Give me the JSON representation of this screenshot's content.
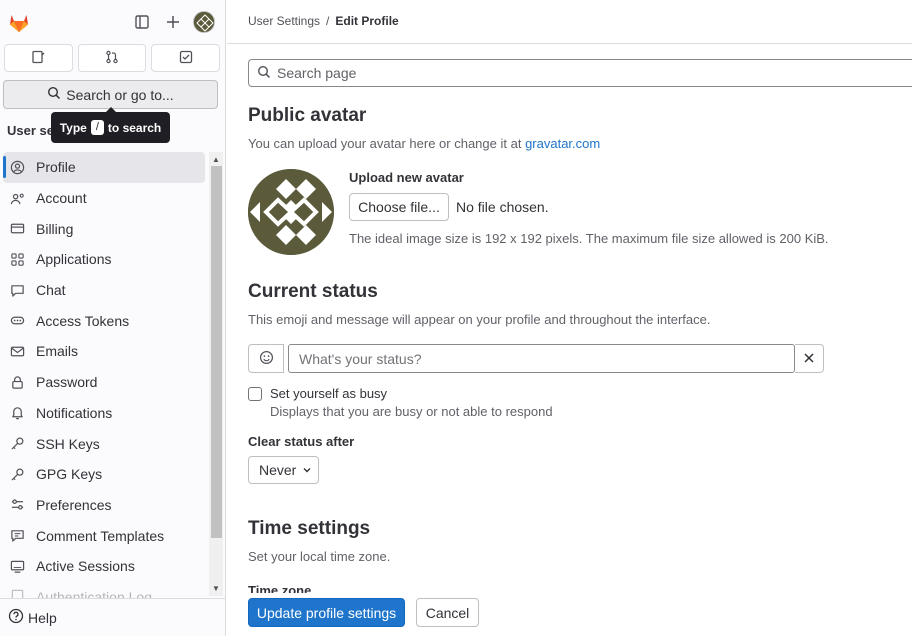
{
  "sidebar": {
    "search_label": "Search or go to...",
    "tooltip": {
      "prefix": "Type",
      "key": "/",
      "suffix": "to search"
    },
    "section_title": "User settings",
    "items": [
      {
        "label": "Profile",
        "icon": "profile-icon",
        "active": true
      },
      {
        "label": "Account",
        "icon": "account-icon"
      },
      {
        "label": "Billing",
        "icon": "billing-icon"
      },
      {
        "label": "Applications",
        "icon": "applications-icon"
      },
      {
        "label": "Chat",
        "icon": "chat-icon"
      },
      {
        "label": "Access Tokens",
        "icon": "access-tokens-icon"
      },
      {
        "label": "Emails",
        "icon": "email-icon"
      },
      {
        "label": "Password",
        "icon": "lock-icon"
      },
      {
        "label": "Notifications",
        "icon": "bell-icon"
      },
      {
        "label": "SSH Keys",
        "icon": "key-icon"
      },
      {
        "label": "GPG Keys",
        "icon": "key-icon"
      },
      {
        "label": "Preferences",
        "icon": "preferences-icon"
      },
      {
        "label": "Comment Templates",
        "icon": "comment-icon"
      },
      {
        "label": "Active Sessions",
        "icon": "monitor-icon"
      },
      {
        "label": "Authentication Log",
        "icon": "log-icon"
      }
    ],
    "help_label": "Help"
  },
  "breadcrumb": {
    "parent": "User Settings",
    "separator": "/",
    "current": "Edit Profile"
  },
  "search_page": {
    "placeholder": "Search page"
  },
  "avatar_section": {
    "title": "Public avatar",
    "description": "You can upload your avatar here or change it at",
    "link": "gravatar.com",
    "upload_label": "Upload new avatar",
    "choose_button": "Choose file...",
    "no_file": "No file chosen.",
    "hint": "The ideal image size is 192 x 192 pixels. The maximum file size allowed is 200 KiB."
  },
  "status_section": {
    "title": "Current status",
    "description": "This emoji and message will appear on your profile and throughout the interface.",
    "placeholder": "What's your status?",
    "busy_label": "Set yourself as busy",
    "busy_help": "Displays that you are busy or not able to respond",
    "clear_label": "Clear status after",
    "clear_value": "Never"
  },
  "time_section": {
    "title": "Time settings",
    "description": "Set your local time zone.",
    "tz_label": "Time zone"
  },
  "footer": {
    "primary": "Update profile settings",
    "cancel": "Cancel"
  },
  "colors": {
    "accent": "#1f75cb",
    "avatar": "#5b5a3a",
    "logo": "#e24329"
  }
}
